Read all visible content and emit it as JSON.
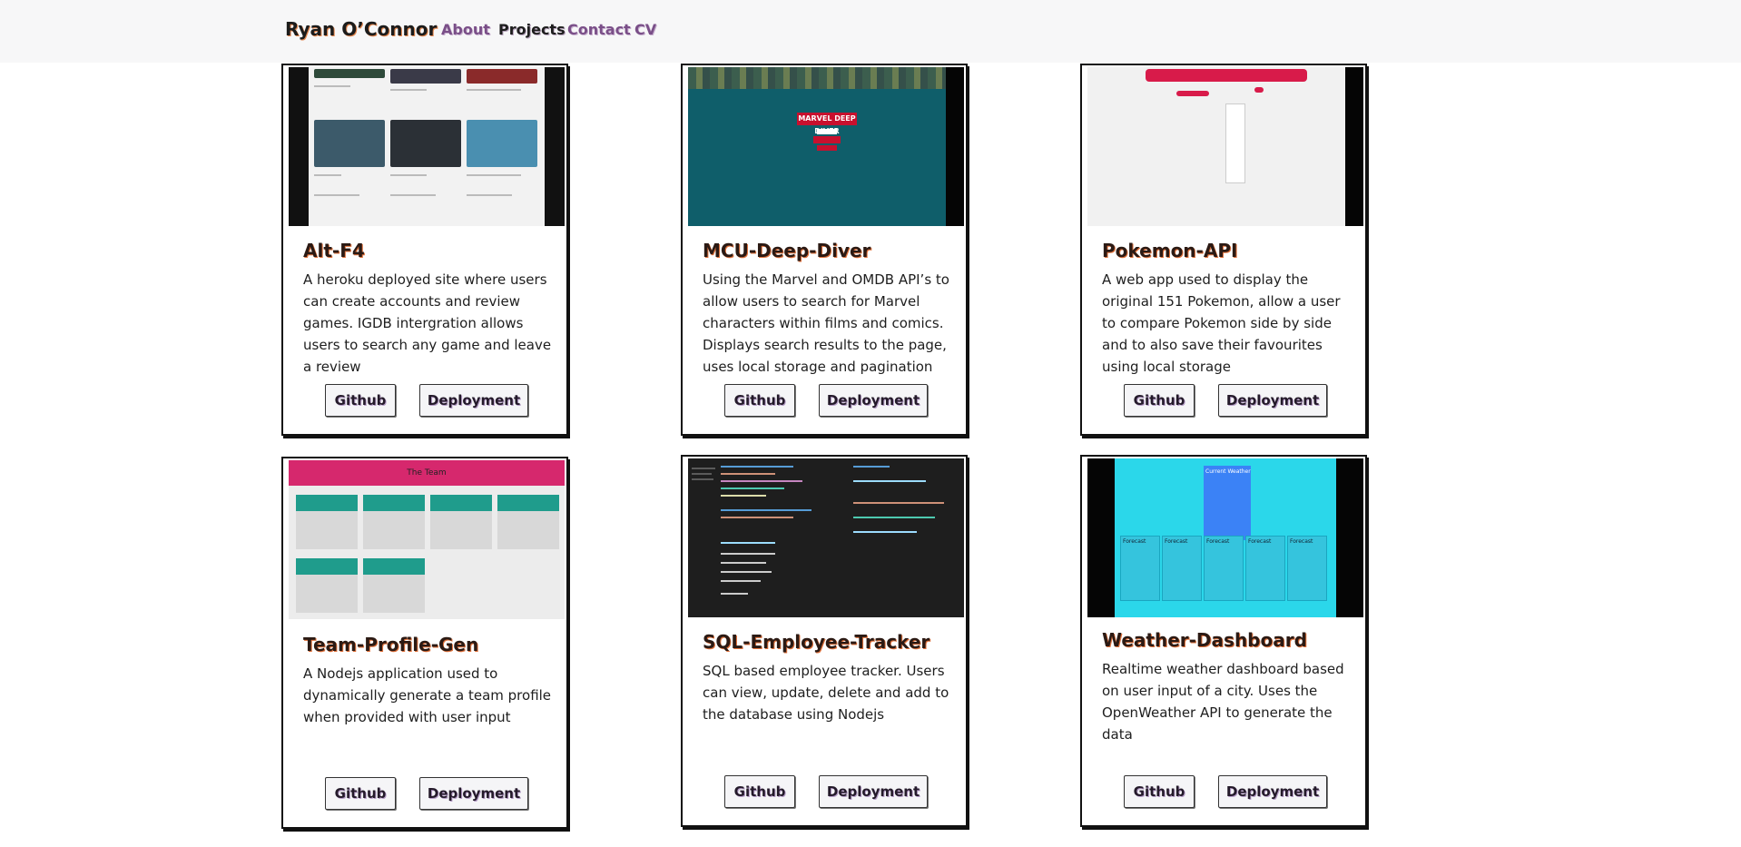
{
  "nav": {
    "brand": "Ryan O’Connor",
    "links": [
      "About",
      "Projects",
      "Contact",
      "CV"
    ],
    "active": "Projects"
  },
  "projects": [
    {
      "title": "Alt-F4",
      "description": "A heroku deployed site where users can create accounts and review games. IGDB intergration allows users to search any game and leave a review",
      "github_label": "Github",
      "deploy_label": "Deployment"
    },
    {
      "title": "MCU-Deep-Diver",
      "description": "Using the Marvel and OMDB API’s to allow users to search for Marvel characters within films and comics. Displays search results to the page, uses local storage and pagination",
      "github_label": "Github",
      "deploy_label": "Deployment",
      "thumb_logo": "MARVEL DEEP DIVER"
    },
    {
      "title": "Pokemon-API",
      "description": "A web app used to display the original 151 Pokemon, allow a user to compare Pokemon side by side and to also save their favourites using local storage",
      "github_label": "Github",
      "deploy_label": "Deployment"
    },
    {
      "title": "Team-Profile-Gen",
      "description": "A Nodejs application used to dynamically generate a team profile when provided with user input",
      "github_label": "Github",
      "deploy_label": "Deployment",
      "thumb_header": "The Team"
    },
    {
      "title": "SQL-Employee-Tracker",
      "description": "SQL based employee tracker. Users can view, update, delete and add to the database using Nodejs",
      "github_label": "Github",
      "deploy_label": "Deployment"
    },
    {
      "title": "Weather-Dashboard",
      "description": "Realtime weather dashboard based on user input of a city. Uses the OpenWeather API to generate the data",
      "github_label": "Github",
      "deploy_label": "Deployment",
      "thumb_current": "Current Weather",
      "thumb_forecast": "Forecast"
    }
  ],
  "colors": {
    "nav_bg": "#f7f7f8",
    "nav_link": "#7a4f88",
    "title_shadow": "#e0713b",
    "card_border": "#111111"
  }
}
